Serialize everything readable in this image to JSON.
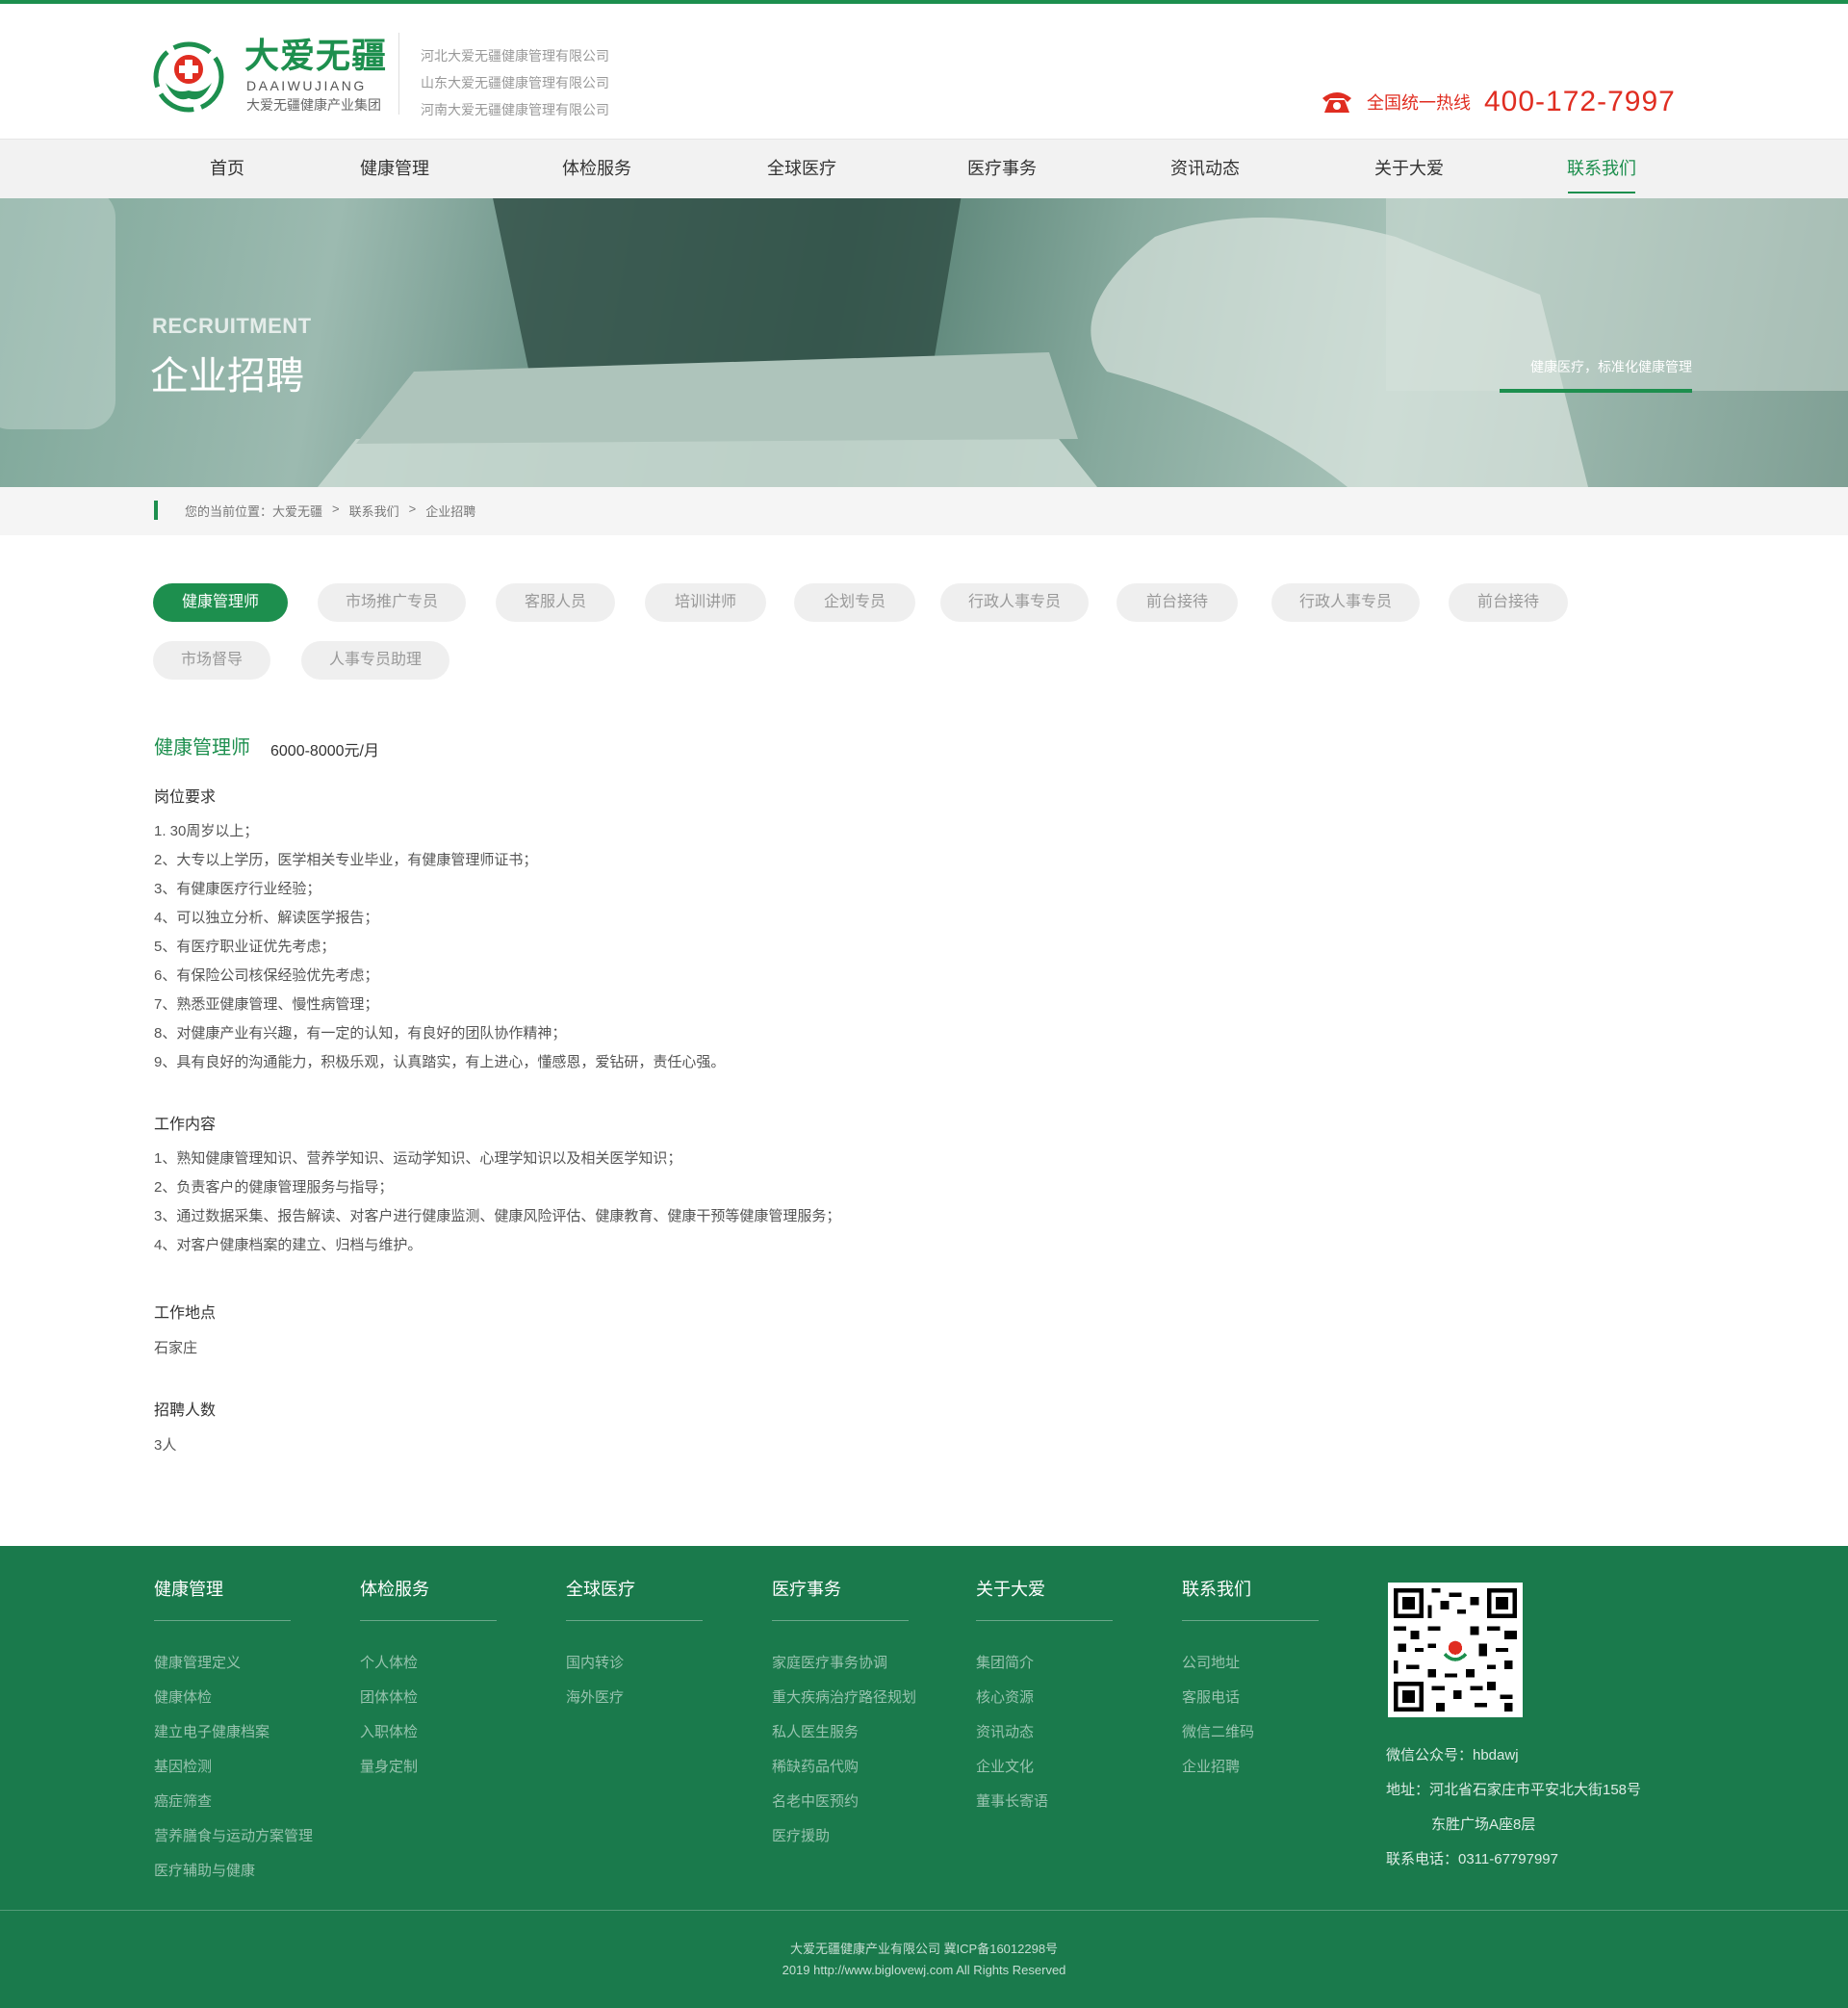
{
  "brand": {
    "name_cn": "大爱无疆",
    "name_en": "DAAIWUJIANG",
    "subtitle": "大爱无疆健康产业集团",
    "companies": [
      "河北大爱无疆健康管理有限公司",
      "山东大爱无疆健康管理有限公司",
      "河南大爱无疆健康管理有限公司"
    ]
  },
  "hotline": {
    "label": "全国统一热线",
    "number": "400-172-7997",
    "icon": "phone-icon"
  },
  "nav": [
    "首页",
    "健康管理",
    "体检服务",
    "全球医疗",
    "医疗事务",
    "资讯动态",
    "关于大爱",
    "联系我们"
  ],
  "nav_active": "联系我们",
  "banner": {
    "en": "RECRUITMENT",
    "cn": "企业招聘",
    "slogan": "健康医疗，标准化健康管理"
  },
  "breadcrumb": {
    "prefix": "您的当前位置：",
    "items": [
      "大爱无疆",
      "联系我们",
      "企业招聘"
    ],
    "sep": ">"
  },
  "tabs": [
    "健康管理师",
    "市场推广专员",
    "客服人员",
    "培训讲师",
    "企划专员",
    "行政人事专员",
    "前台接待",
    "行政人事专员",
    "前台接待",
    "市场督导",
    "人事专员助理"
  ],
  "tab_active": "健康管理师",
  "job": {
    "title": "健康管理师",
    "salary": "6000-8000元/月",
    "req_h": "岗位要求",
    "req": [
      "1.   30周岁以上；",
      "2、大专以上学历，医学相关专业毕业，有健康管理师证书；",
      "3、有健康医疗行业经验；",
      "4、可以独立分析、解读医学报告；",
      "5、有医疗职业证优先考虑；",
      "6、有保险公司核保经验优先考虑；",
      "7、熟悉亚健康管理、慢性病管理；",
      "8、对健康产业有兴趣，有一定的认知，有良好的团队协作精神；",
      "9、具有良好的沟通能力，积极乐观，认真踏实，有上进心，懂感恩，爱钻研，责任心强。"
    ],
    "duty_h": "工作内容",
    "duty": [
      "1、熟知健康管理知识、营养学知识、运动学知识、心理学知识以及相关医学知识；",
      "2、负责客户的健康管理服务与指导；",
      "3、通过数据采集、报告解读、对客户进行健康监测、健康风险评估、健康教育、健康干预等健康管理服务；",
      "4、对客户健康档案的建立、归档与维护。"
    ],
    "loc_h": "工作地点",
    "loc": "石家庄",
    "num_h": "招聘人数",
    "num": "3人"
  },
  "footer": {
    "cols": [
      {
        "title": "健康管理",
        "items": [
          "健康管理定义",
          "健康体检",
          "建立电子健康档案",
          "基因检测",
          "癌症筛查",
          "营养膳食与运动方案管理",
          "医疗辅助与健康"
        ]
      },
      {
        "title": "体检服务",
        "items": [
          "个人体检",
          "团体体检",
          "入职体检",
          "量身定制"
        ]
      },
      {
        "title": "全球医疗",
        "items": [
          "国内转诊",
          "海外医疗"
        ]
      },
      {
        "title": "医疗事务",
        "items": [
          "家庭医疗事务协调",
          "重大疾病治疗路径规划",
          "私人医生服务",
          "稀缺药品代购",
          "名老中医预约",
          "医疗援助"
        ]
      },
      {
        "title": "关于大爱",
        "items": [
          "集团简介",
          "核心资源",
          "资讯动态",
          "企业文化",
          "董事长寄语"
        ]
      },
      {
        "title": "联系我们",
        "items": [
          "公司地址",
          "客服电话",
          "微信二维码",
          "企业招聘"
        ]
      }
    ],
    "wechat": "微信公众号：hbdawj",
    "address1": "地址：河北省石家庄市平安北大街158号",
    "address2": "东胜广场A座8层",
    "phone": "联系电话：0311-67797997",
    "copyright1": "大爱无疆健康产业有限公司 冀ICP备16012298号",
    "copyright2": "2019 http://www.biglovewj.com All Rights Reserved"
  },
  "colors": {
    "brand_green": "#1d8f4e",
    "footer_green": "#1a7a4c",
    "hotline_red": "#e02d21"
  }
}
